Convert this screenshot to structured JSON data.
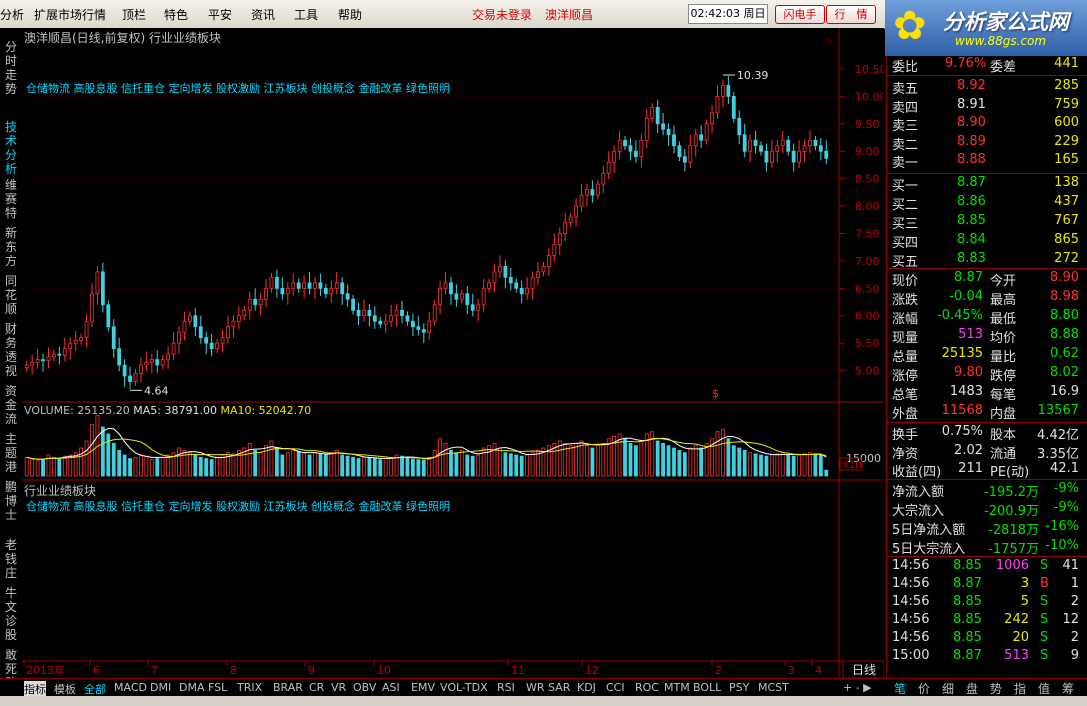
{
  "menu": {
    "items": [
      "分析",
      "扩展市场行情",
      "顶栏",
      "特色",
      "平安",
      "资讯",
      "工具",
      "帮助"
    ],
    "trade_status": "交易未登录",
    "stock_name": "澳洋顺昌",
    "clock": "02:42:03 周日",
    "btn_flash": "闪电手",
    "btn_quote": "行　情"
  },
  "logo": {
    "title": "分析家公式网",
    "url": "www.88gs.com"
  },
  "left_tabs": [
    "分时走势",
    "技术分析",
    "维赛特",
    "新东方",
    "同花顺",
    "财务透视",
    "资金流",
    "主题港",
    "鹏博士",
    "老钱庄",
    "牛文诊股",
    "敢死队"
  ],
  "chart": {
    "title": "澳洋顺昌(日线,前复权)",
    "subtitle": "行业业绩板块",
    "concepts": "仓储物流 高股息股 信托重仓 定向增发 股权激励 江苏板块 创投概念 金融改革 绿色照明",
    "high_label": "10.39",
    "low_label": "4.64",
    "volume_line": {
      "vol": "VOLUME: 25135.20",
      "ma5": "MA5: 38791.00",
      "ma10": "MA10: 52042.70"
    },
    "vol_axis": "15000",
    "vol_unit": "X10",
    "ind_title": "行业业绩板块",
    "period": "日线",
    "time_labels": [
      "2013年",
      "6",
      "7",
      "8",
      "9",
      "10",
      "11",
      "12",
      "",
      "2",
      "3",
      "4"
    ]
  },
  "chart_data": {
    "type": "candlestick",
    "ylim": [
      4.5,
      10.7
    ],
    "yticks": [
      5.0,
      5.5,
      6.0,
      6.5,
      7.0,
      7.5,
      8.0,
      8.5,
      9.0,
      9.5,
      10.0,
      10.5
    ],
    "ytick_labels": [
      "5.00",
      "5.50",
      "6.00",
      "6.50",
      "7.00",
      "7.50",
      "8.00",
      "8.50",
      "9.00",
      "9.50",
      "10.00",
      "10.50"
    ],
    "close": [
      5.1,
      5.15,
      5.2,
      5.18,
      5.25,
      5.3,
      5.28,
      5.4,
      5.5,
      5.55,
      5.6,
      5.9,
      6.4,
      6.8,
      6.2,
      5.8,
      5.4,
      5.1,
      4.9,
      4.8,
      4.95,
      5.1,
      5.15,
      5.2,
      5.1,
      5.2,
      5.3,
      5.5,
      5.7,
      5.9,
      6.0,
      5.8,
      5.6,
      5.5,
      5.4,
      5.5,
      5.6,
      5.8,
      5.9,
      6.0,
      6.1,
      6.3,
      6.2,
      6.3,
      6.5,
      6.7,
      6.5,
      6.4,
      6.5,
      6.6,
      6.5,
      6.6,
      6.5,
      6.6,
      6.5,
      6.4,
      6.5,
      6.6,
      6.4,
      6.3,
      6.1,
      6.0,
      6.1,
      6.0,
      5.9,
      5.85,
      5.9,
      6.0,
      6.1,
      6.0,
      5.9,
      5.8,
      5.75,
      5.7,
      5.9,
      6.2,
      6.5,
      6.6,
      6.4,
      6.3,
      6.4,
      6.2,
      6.1,
      6.2,
      6.5,
      6.6,
      6.8,
      6.9,
      6.7,
      6.6,
      6.5,
      6.4,
      6.5,
      6.7,
      6.8,
      6.9,
      7.1,
      7.3,
      7.5,
      7.7,
      7.8,
      8.0,
      8.2,
      8.3,
      8.2,
      8.4,
      8.6,
      8.8,
      9.0,
      9.2,
      9.1,
      9.0,
      8.9,
      9.2,
      9.6,
      9.8,
      9.5,
      9.4,
      9.3,
      9.1,
      8.9,
      8.8,
      9.1,
      9.3,
      9.2,
      9.5,
      9.7,
      10.0,
      10.2,
      10.0,
      9.6,
      9.3,
      9.0,
      9.2,
      9.1,
      9.0,
      8.8,
      9.0,
      9.1,
      9.2,
      9.0,
      8.8,
      9.0,
      9.1,
      9.2,
      9.1,
      9.0,
      8.87
    ],
    "high": 10.39,
    "low": 4.64,
    "volume_ylim": [
      0,
      30000
    ],
    "volume": [
      8000,
      7000,
      6500,
      7200,
      9000,
      8000,
      7500,
      8500,
      9000,
      10000,
      12000,
      15000,
      22000,
      26000,
      21000,
      18000,
      14000,
      11000,
      9000,
      7500,
      8000,
      9000,
      8500,
      7000,
      7500,
      8000,
      9000,
      10000,
      12000,
      11000,
      10000,
      9000,
      8000,
      7500,
      7000,
      8000,
      9000,
      10000,
      9500,
      11000,
      12000,
      14000,
      11000,
      10000,
      13000,
      15000,
      12000,
      9000,
      10000,
      11000,
      10500,
      9500,
      9000,
      10000,
      9500,
      9000,
      10000,
      11000,
      9000,
      8500,
      8000,
      7500,
      8000,
      7800,
      7500,
      7000,
      7500,
      8000,
      9000,
      8500,
      7800,
      7200,
      7000,
      6800,
      8000,
      11000,
      16000,
      14000,
      11000,
      10000,
      11000,
      9000,
      8500,
      9000,
      12000,
      13000,
      14000,
      12000,
      10000,
      9500,
      9000,
      8500,
      9000,
      10000,
      11000,
      12000,
      13000,
      14000,
      15000,
      14000,
      13000,
      14000,
      15000,
      13000,
      12000,
      13000,
      14000,
      16000,
      17000,
      18000,
      16000,
      14000,
      13000,
      15000,
      18000,
      19000,
      15000,
      14000,
      13000,
      12000,
      11000,
      10000,
      12000,
      13000,
      12000,
      14000,
      16000,
      19000,
      20000,
      16000,
      13000,
      12000,
      11000,
      10000,
      9500,
      9000,
      8500,
      9000,
      9500,
      10000,
      9000,
      8500,
      9000,
      9500,
      10000,
      9500,
      9000,
      2513
    ]
  },
  "quote": {
    "weibi_label": "委比",
    "weibi": "9.76%",
    "weicha_label": "委差",
    "weicha": "441",
    "asks": [
      {
        "label": "卖五",
        "price": "8.92",
        "vol": "285"
      },
      {
        "label": "卖四",
        "price": "8.91",
        "vol": "759"
      },
      {
        "label": "卖三",
        "price": "8.90",
        "vol": "600"
      },
      {
        "label": "卖二",
        "price": "8.89",
        "vol": "229"
      },
      {
        "label": "卖一",
        "price": "8.88",
        "vol": "165"
      }
    ],
    "bids": [
      {
        "label": "买一",
        "price": "8.87",
        "vol": "138"
      },
      {
        "label": "买二",
        "price": "8.86",
        "vol": "437"
      },
      {
        "label": "买三",
        "price": "8.85",
        "vol": "767"
      },
      {
        "label": "买四",
        "price": "8.84",
        "vol": "865"
      },
      {
        "label": "买五",
        "price": "8.83",
        "vol": "272"
      }
    ],
    "stats": [
      {
        "l1": "现价",
        "v1": "8.87",
        "l2": "今开",
        "v2": "8.90"
      },
      {
        "l1": "涨跌",
        "v1": "-0.04",
        "l2": "最高",
        "v2": "8.98"
      },
      {
        "l1": "涨幅",
        "v1": "-0.45%",
        "l2": "最低",
        "v2": "8.80"
      },
      {
        "l1": "现量",
        "v1": "513",
        "l2": "均价",
        "v2": "8.88"
      },
      {
        "l1": "总量",
        "v1": "25135",
        "l2": "量比",
        "v2": "0.62"
      },
      {
        "l1": "涨停",
        "v1": "9.80",
        "l2": "跌停",
        "v2": "8.02"
      },
      {
        "l1": "总笔",
        "v1": "1483",
        "l2": "每笔",
        "v2": "16.9"
      },
      {
        "l1": "外盘",
        "v1": "11568",
        "l2": "内盘",
        "v2": "13567"
      }
    ],
    "fund": [
      {
        "l1": "换手",
        "v1": "0.75%",
        "l2": "股本",
        "v2": "4.42亿"
      },
      {
        "l1": "净资",
        "v1": "2.02",
        "l2": "流通",
        "v2": "3.35亿"
      },
      {
        "l1": "收益(四)",
        "v1": "211",
        "l2": "PE(动)",
        "v2": "42.1"
      }
    ],
    "flows": [
      {
        "label": "净流入额",
        "val": "-195.2万",
        "pct": "-9%"
      },
      {
        "label": "大宗流入",
        "val": "-200.9万",
        "pct": "-9%"
      },
      {
        "label": "5日净流入额",
        "val": "-2818万",
        "pct": "-16%"
      },
      {
        "label": "5日大宗流入",
        "val": "-1757万",
        "pct": "-10%"
      }
    ],
    "ticks": [
      {
        "t": "14:56",
        "p": "8.85",
        "v": "1006",
        "s": "S",
        "n": "41"
      },
      {
        "t": "14:56",
        "p": "8.87",
        "v": "3",
        "s": "B",
        "n": "1"
      },
      {
        "t": "14:56",
        "p": "8.85",
        "v": "5",
        "s": "S",
        "n": "2"
      },
      {
        "t": "14:56",
        "p": "8.85",
        "v": "242",
        "s": "S",
        "n": "12"
      },
      {
        "t": "14:56",
        "p": "8.85",
        "v": "20",
        "s": "S",
        "n": "2"
      },
      {
        "t": "15:00",
        "p": "8.87",
        "v": "513",
        "s": "S",
        "n": "9"
      }
    ]
  },
  "bottom": {
    "tabs": [
      "指标",
      "模板",
      "全部",
      "MACD",
      "DMI",
      "DMA",
      "FSL",
      "TRIX",
      "BRAR",
      "CR",
      "VR",
      "OBV",
      "ASI",
      "EMV",
      "VOL-TDX",
      "RSI",
      "WR",
      "SAR",
      "KDJ",
      "CCI",
      "ROC",
      "MTM",
      "BOLL",
      "PSY",
      "MCST"
    ],
    "right_tabs": [
      "笔",
      "价",
      "细",
      "盘",
      "势",
      "指",
      "值",
      "筹"
    ]
  },
  "colors": {
    "up": "#ff3030",
    "down": "#40d0e0",
    "grid": "#800000",
    "ma5": "#ffffff",
    "ma10": "#e8e800"
  }
}
